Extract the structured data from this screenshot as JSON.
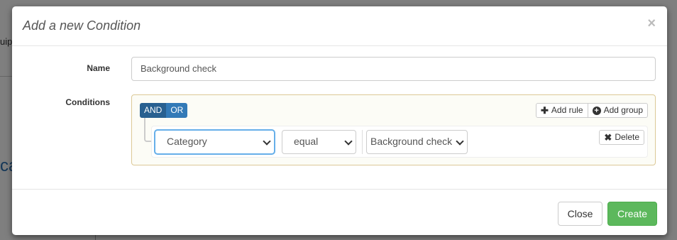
{
  "background": {
    "fragment_1": "uip",
    "fragment_2": "ca"
  },
  "modal": {
    "title": "Add a new Condition",
    "close_glyph": "×",
    "name_label": "Name",
    "name_value": "Background check",
    "conditions_label": "Conditions",
    "query_builder": {
      "and_label": "AND",
      "or_label": "OR",
      "active_condition": "AND",
      "add_rule_label": "Add rule",
      "add_group_label": "Add group",
      "rule": {
        "field": "Category",
        "operator": "equal",
        "value": "Background check",
        "delete_label": "Delete"
      }
    },
    "footer": {
      "close_label": "Close",
      "create_label": "Create"
    }
  },
  "colors": {
    "and_active": "#286090",
    "or": "#337ab7",
    "create_button": "#5cb85c",
    "group_border": "#dcc896"
  },
  "icons": {
    "add_rule": "plus-icon",
    "add_group": "plus-circle-icon",
    "delete": "x-icon",
    "select": "chevron-down-icon"
  }
}
